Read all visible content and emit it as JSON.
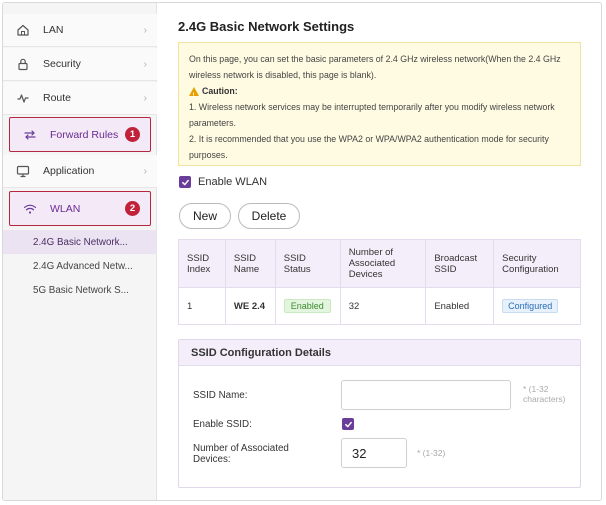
{
  "sidebar": {
    "items": [
      {
        "label": "LAN",
        "icon": "home-icon"
      },
      {
        "label": "Security",
        "icon": "lock-icon"
      },
      {
        "label": "Route",
        "icon": "route-icon"
      },
      {
        "label": "Forward Rules",
        "icon": "forward-icon",
        "badge": "1"
      },
      {
        "label": "Application",
        "icon": "monitor-icon"
      },
      {
        "label": "WLAN",
        "icon": "wifi-icon",
        "badge": "2"
      }
    ],
    "chevron": "›",
    "sub_items": [
      {
        "label": "2.4G Basic Network..."
      },
      {
        "label": "2.4G Advanced Netw..."
      },
      {
        "label": "5G Basic Network S..."
      }
    ]
  },
  "main": {
    "title": "2.4G Basic Network Settings",
    "note": {
      "line1": "On this page, you can set the basic parameters of 2.4 GHz wireless network(When the 2.4 GHz wireless network is disabled, this page is blank).",
      "caution": "Caution:",
      "point1": "1. Wireless network services may be interrupted temporarily after you modify wireless network parameters.",
      "point2": "2. It is recommended that you use the WPA2 or WPA/WPA2 authentication mode for security purposes."
    },
    "enable_wlan_label": "Enable WLAN",
    "buttons": {
      "new": "New",
      "delete": "Delete"
    },
    "table": {
      "headers": [
        "SSID Index",
        "SSID Name",
        "SSID Status",
        "Number of Associated Devices",
        "Broadcast SSID",
        "Security Configuration"
      ],
      "rows": [
        {
          "index": "1",
          "name": "WE 2.4",
          "status": "Enabled",
          "devices": "32",
          "broadcast": "Enabled",
          "security": "Configured"
        }
      ]
    },
    "details": {
      "title": "SSID Configuration Details",
      "ssid_name_label": "SSID Name:",
      "ssid_name_value": "",
      "ssid_name_hint": "* (1-32 characters)",
      "enable_ssid_label": "Enable SSID:",
      "devices_label": "Number of Associated Devices:",
      "devices_value": "32",
      "devices_hint": "* (1-32)"
    }
  },
  "colors": {
    "accent": "#6a3d9a",
    "highlight_border": "#b5273f",
    "badge": "#c0223a",
    "note_bg": "#fffbe2"
  }
}
